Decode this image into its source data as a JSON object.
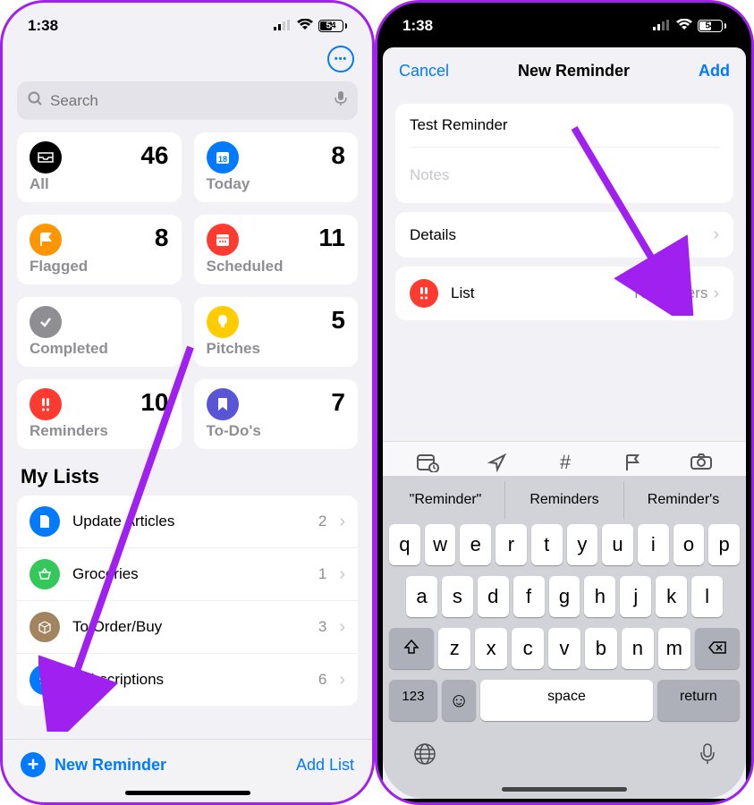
{
  "status": {
    "time": "1:38",
    "battery": "54"
  },
  "left": {
    "search_placeholder": "Search",
    "cards": [
      {
        "label": "All",
        "count": "46",
        "color": "#000",
        "icon": "tray"
      },
      {
        "label": "Today",
        "count": "8",
        "color": "#007aff",
        "icon": "calendar"
      },
      {
        "label": "Flagged",
        "count": "8",
        "color": "#ff9500",
        "icon": "flag"
      },
      {
        "label": "Scheduled",
        "count": "11",
        "color": "#ff3b30",
        "icon": "calendar"
      },
      {
        "label": "Completed",
        "count": "",
        "color": "#8e8e93",
        "icon": "check"
      },
      {
        "label": "Pitches",
        "count": "5",
        "color": "#ffcc00",
        "icon": "bulb"
      },
      {
        "label": "Reminders",
        "count": "10",
        "color": "#ff3b30",
        "icon": "alert"
      },
      {
        "label": "To-Do's",
        "count": "7",
        "color": "#5856d6",
        "icon": "bookmark"
      }
    ],
    "section": "My Lists",
    "lists": [
      {
        "label": "Update Articles",
        "count": "2",
        "color": "#007aff",
        "icon": "doc"
      },
      {
        "label": "Groceries",
        "count": "1",
        "color": "#34c759",
        "icon": "basket"
      },
      {
        "label": "To Order/Buy",
        "count": "3",
        "color": "#a2845e",
        "icon": "box"
      },
      {
        "label": "Subscriptions",
        "count": "6",
        "color": "#007aff",
        "icon": "repeat"
      }
    ],
    "new_reminder": "New Reminder",
    "add_list": "Add List"
  },
  "right": {
    "cancel": "Cancel",
    "title": "New Reminder",
    "add": "Add",
    "reminder_title": "Test Reminder",
    "notes_placeholder": "Notes",
    "details": "Details",
    "list_label": "List",
    "list_value": "Reminders",
    "suggestions": [
      "\"Reminder\"",
      "Reminders",
      "Reminder's"
    ],
    "keys": {
      "r1": [
        "q",
        "w",
        "e",
        "r",
        "t",
        "y",
        "u",
        "i",
        "o",
        "p"
      ],
      "r2": [
        "a",
        "s",
        "d",
        "f",
        "g",
        "h",
        "j",
        "k",
        "l"
      ],
      "r3": [
        "z",
        "x",
        "c",
        "v",
        "b",
        "n",
        "m"
      ],
      "num": "123",
      "space": "space",
      "return": "return"
    }
  }
}
